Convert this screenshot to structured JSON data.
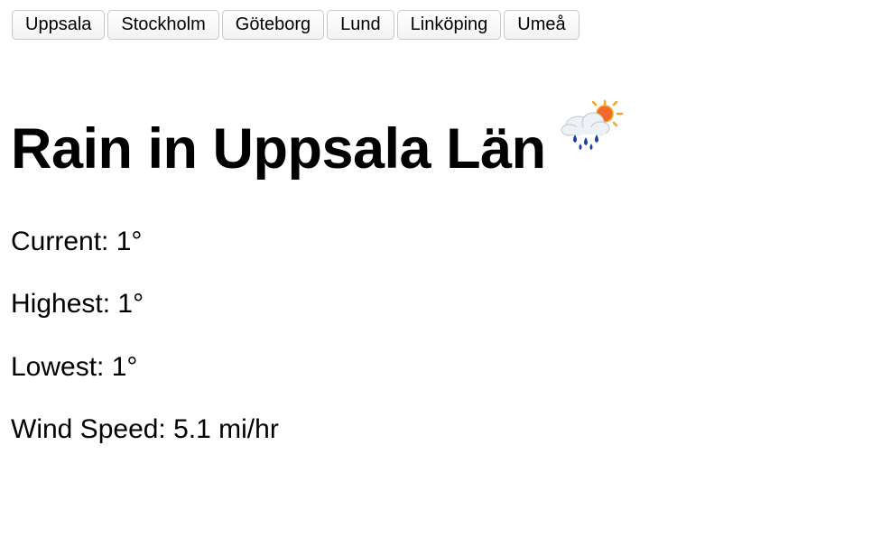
{
  "cities": [
    {
      "label": "Uppsala"
    },
    {
      "label": "Stockholm"
    },
    {
      "label": "Göteborg"
    },
    {
      "label": "Lund"
    },
    {
      "label": "Linköping"
    },
    {
      "label": "Umeå"
    }
  ],
  "weather": {
    "title": "Rain in Uppsala Län",
    "icon": "rain-sun-cloud-icon",
    "current": "Current: 1°",
    "highest": "Highest: 1°",
    "lowest": "Lowest: 1°",
    "wind": "Wind Speed: 5.1 mi/hr"
  }
}
